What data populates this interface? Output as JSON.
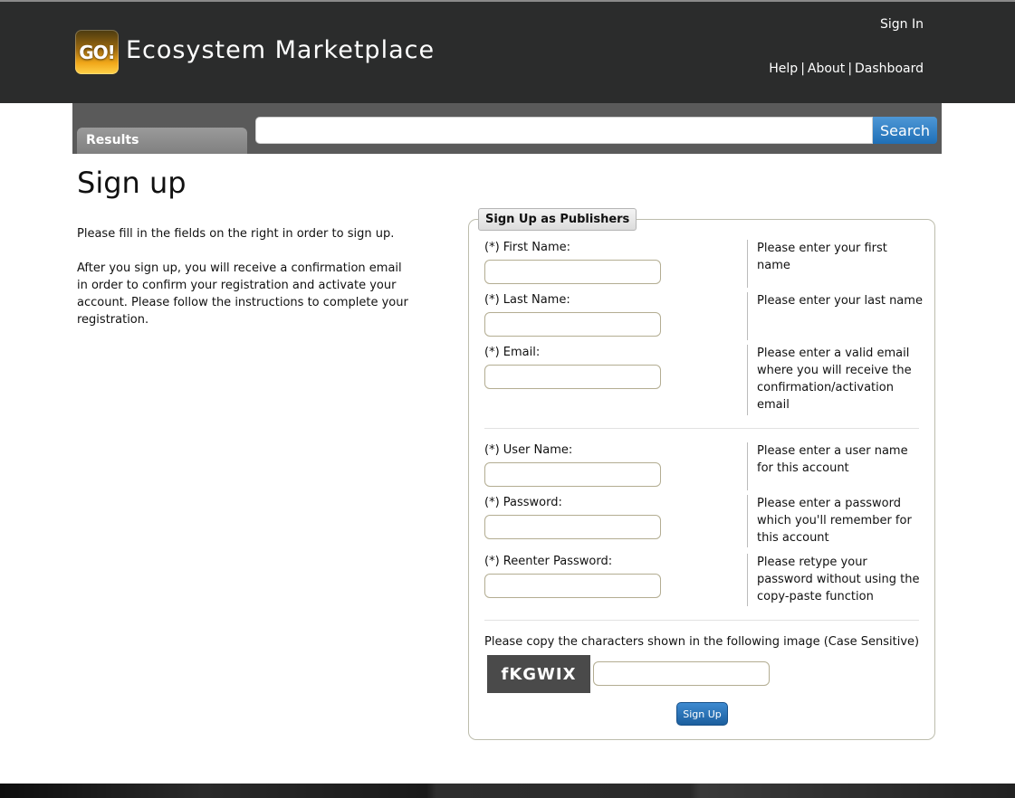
{
  "header": {
    "logo_badge": "GO!",
    "site_title": "Ecosystem Marketplace",
    "sign_in": "Sign In",
    "links": [
      "Help",
      "About",
      "Dashboard"
    ],
    "separator": "|"
  },
  "searchbar": {
    "results_tab": "Results",
    "search_button": "Search",
    "search_value": ""
  },
  "page": {
    "title": "Sign up",
    "intro_1": "Please fill in the fields on the right in order to sign up.",
    "intro_2": "After you sign up, you will receive a confirmation email in order to confirm your registration and activate your account. Please follow the instructions to complete your registration."
  },
  "form": {
    "legend": "Sign Up as Publishers",
    "fields": [
      {
        "label": "(*) First Name:",
        "help": "Please enter your first name",
        "value": ""
      },
      {
        "label": "(*) Last Name:",
        "help": "Please enter your last name",
        "value": ""
      },
      {
        "label": "(*) Email:",
        "help": "Please enter a valid email where you will receive the confirmation/activation email",
        "value": ""
      },
      {
        "label": "(*) User Name:",
        "help": "Please enter a user name for this account",
        "value": ""
      },
      {
        "label": "(*) Password:",
        "help": "Please enter a password which you'll remember for this account",
        "value": ""
      },
      {
        "label": "(*) Reenter Password:",
        "help": "Please retype your password without using the copy-paste function",
        "value": ""
      }
    ],
    "captcha_label": "Please copy the characters shown in the following image (Case Sensitive)",
    "captcha_text": "fKGWIX",
    "submit": "Sign Up"
  },
  "colors": {
    "header_bg": "#2b2c2c",
    "searchbar_bg": "#5a5a5a",
    "accent_blue": "#2a78c2"
  }
}
